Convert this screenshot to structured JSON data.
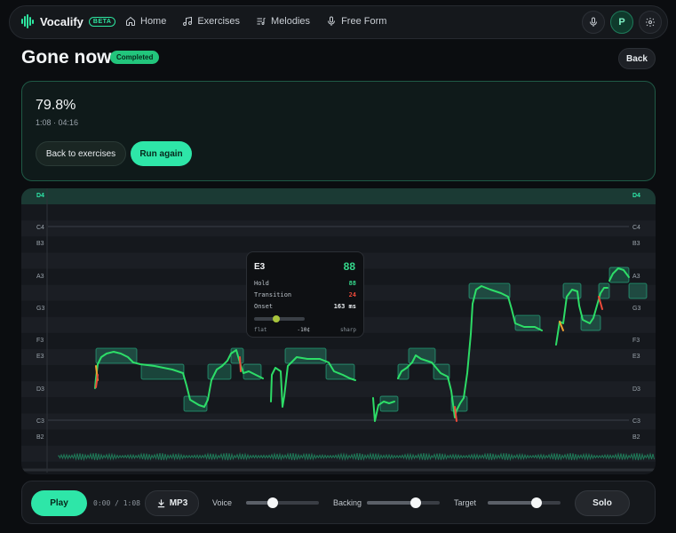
{
  "nav": {
    "brand": "Vocalify",
    "badge": "BETA",
    "links": [
      {
        "label": "Home",
        "icon": "home-icon"
      },
      {
        "label": "Exercises",
        "icon": "music-note-icon"
      },
      {
        "label": "Melodies",
        "icon": "music-list-icon"
      },
      {
        "label": "Free Form",
        "icon": "microphone-icon"
      }
    ],
    "avatar": "P"
  },
  "header": {
    "title": "Gone now",
    "status": "Completed",
    "back_label": "Back"
  },
  "result": {
    "score": "79.8%",
    "range": "1:08 · 04:16",
    "back_to_exercises": "Back to exercises",
    "run_again": "Run again"
  },
  "pitch": {
    "left_labels": [
      "D4",
      "C4",
      "B3",
      "A3",
      "G3",
      "F3",
      "E3",
      "D3",
      "C3",
      "B2"
    ],
    "right_labels": [
      "D4",
      "C4",
      "B3",
      "A3",
      "G3",
      "F3",
      "E3",
      "D3",
      "C3",
      "B2"
    ]
  },
  "tooltip": {
    "note": "E3",
    "score": "88",
    "hold_label": "Hold",
    "hold_value": "88",
    "transition_label": "Transition",
    "transition_value": "24",
    "onset_label": "Onset",
    "onset_value": "163 ms",
    "flat_label": "flat",
    "offset_label": "-10¢",
    "sharp_label": "sharp",
    "offset_fraction": 0.44
  },
  "player": {
    "play_label": "Play",
    "time": "0:00 / 1:08",
    "mp3_label": "MP3",
    "voice_label": "Voice",
    "voice_level": 0.36,
    "backing_label": "Backing",
    "backing_level": 0.67,
    "target_label": "Target",
    "target_level": 0.67,
    "solo_label": "Solo"
  },
  "colors": {
    "accent": "#2ee6a8",
    "good": "#35d98c",
    "bad": "#f04a3a"
  }
}
